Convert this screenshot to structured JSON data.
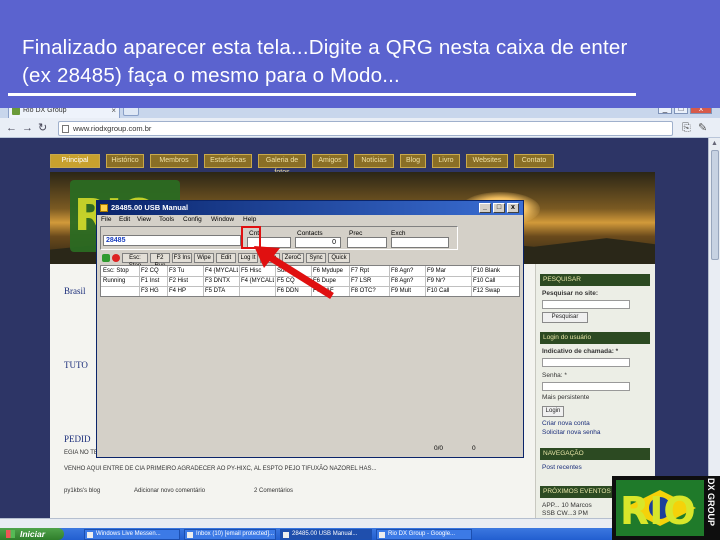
{
  "slide": {
    "title": "Finalizado aparecer esta tela...Digite a QRG nesta caixa de enter (ex 28485) faça o mesmo para o Modo..."
  },
  "browser": {
    "tab_title": "Rio DX Group",
    "address": "www.riodxgroup.com.br",
    "nav_items": [
      "Principal",
      "Histórico",
      "Membros",
      "Estatísticas",
      "Galeria de fotos",
      "Amigos",
      "Notícias",
      "Blog",
      "Livro",
      "Websites",
      "Contato"
    ],
    "active_nav": "Principal"
  },
  "site": {
    "section_brasil": "Brasil",
    "section_tuto": "TUTO",
    "section_pedido": "PEDID",
    "sidebar": {
      "search_head": "PESQUISAR",
      "search_label": "Pesquisar no site:",
      "search_button": "Pesquisar",
      "login_head": "Login do usuário",
      "callsign_label": "Indicativo de chamada: *",
      "password_label": "Senha: *",
      "remember_label": "Mais persistente",
      "login_button": "Login",
      "create_account": "Criar nova conta",
      "request_password": "Solicitar nova senha",
      "nav_head": "NAVEGAÇÃO",
      "recent_posts": "Post recentes",
      "next_events_head": "PRÓXIMOS EVENTOS",
      "event_line1": "APP... 10 Marcos",
      "event_line2": "SSB CW...3 PM"
    },
    "content_lines": [
      "EGIA NO TE AOS COLEGAS E AS LE ATAS....",
      "VENHO AQUI ENTRE DE CIA PRIMEIRO AGRADECER AO PY-HIXC, AL ESPTO PEJO TIFUXÃO NAZOREL HAS..."
    ],
    "footer_links": [
      "py1kbs's blog",
      "Adicionar novo comentário",
      "2 Comentários"
    ]
  },
  "dialog": {
    "title": "28485.00 USB Manual",
    "menu": [
      "File",
      "Edit",
      "View",
      "Tools",
      "Config",
      "Window",
      "Help"
    ],
    "entry_value": "28485",
    "labels": [
      "Cnt",
      "Contacts",
      "Prec",
      "Exch"
    ],
    "count_value": "0",
    "buttons": [
      "Esc: Stop",
      "F2 Run",
      "F3 Ins",
      "Wipe",
      "Edit",
      "Log It",
      "Stop",
      "ZeroC",
      "Sync",
      "Quick"
    ],
    "grid": [
      [
        "Esc: Stop",
        "F2 CQ",
        "F3 Tu",
        "F4 {MYCALL}",
        "F5 Hisc",
        "Sort",
        "F6 Mydupe",
        "F7 Rpt",
        "F8 Agn?",
        "F9 Mar",
        "F10 Blank"
      ],
      [
        "Running",
        "F1 Inst",
        "F2 Hist",
        "F3 DNTX",
        "F4 {MYCALL}",
        "F5 CQ",
        "F6 Dupe",
        "F7 LSR",
        "F8 Agn?",
        "F9 Nr?",
        "F10 Call"
      ],
      [
        "",
        "F3 HG",
        "F4 HP",
        "F5 DTA",
        "",
        "F6 DDN",
        "F7 DAF",
        "F8 OTC?",
        "F9 Mult",
        "F10 Call",
        "F12 Swap"
      ]
    ],
    "status_left": "0/0",
    "status_right": "0"
  },
  "taskbar": {
    "start_label": "Iniciar",
    "tasks": [
      "Windows Live Messen...",
      "Inbox (10) [email protected]...",
      "28485.00 USB Manual...",
      "Rio DX Group - Google..."
    ],
    "active_task": 2
  },
  "logo": {
    "text": "RIO",
    "subtext": "DX GROUP"
  },
  "colors": {
    "banner": "#5b63cf",
    "highlight": "#e01010",
    "dialog_title": "#0a246a"
  }
}
